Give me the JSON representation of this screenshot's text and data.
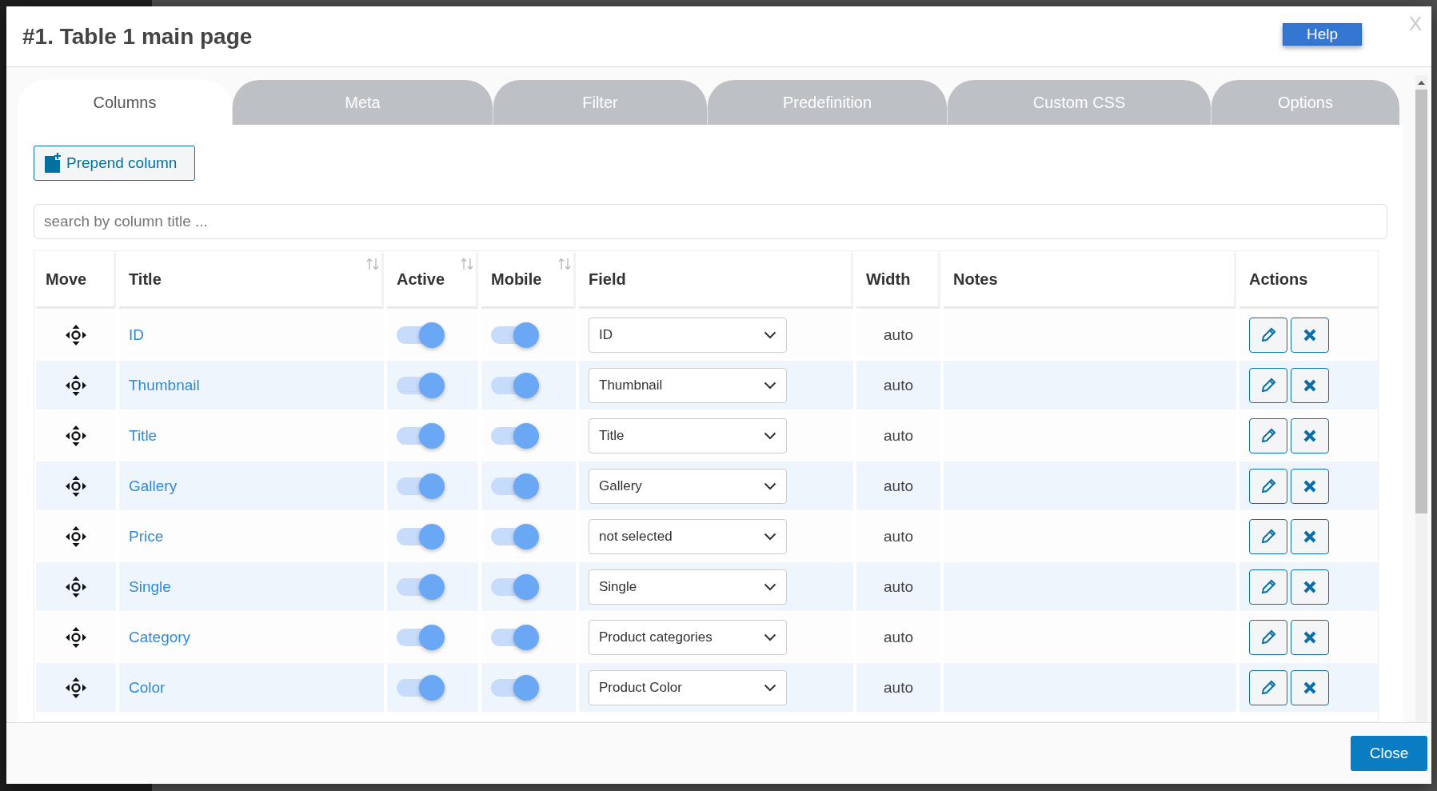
{
  "dialog": {
    "title": "#1. Table 1 main page",
    "help_button": "Help",
    "close_x": "X",
    "close_button": "Close"
  },
  "tabs": [
    {
      "label": "Columns",
      "selected": true
    },
    {
      "label": "Meta",
      "selected": false
    },
    {
      "label": "Filter",
      "selected": false
    },
    {
      "label": "Predefinition",
      "selected": false
    },
    {
      "label": "Custom CSS",
      "selected": false
    },
    {
      "label": "Options",
      "selected": false
    }
  ],
  "prepend_button": "Prepend column",
  "search": {
    "placeholder": "search by column title ..."
  },
  "table": {
    "columns": [
      {
        "label": "Move",
        "sortable": false
      },
      {
        "label": "Title",
        "sortable": true
      },
      {
        "label": "Active",
        "sortable": true
      },
      {
        "label": "Mobile",
        "sortable": true
      },
      {
        "label": "Field",
        "sortable": false
      },
      {
        "label": "Width",
        "sortable": false
      },
      {
        "label": "Notes",
        "sortable": false
      },
      {
        "label": "Actions",
        "sortable": false
      }
    ],
    "rows": [
      {
        "title": "ID",
        "active": true,
        "mobile": true,
        "field": "ID",
        "width": "auto"
      },
      {
        "title": "Thumbnail",
        "active": true,
        "mobile": true,
        "field": "Thumbnail",
        "width": "auto"
      },
      {
        "title": "Title",
        "active": true,
        "mobile": true,
        "field": "Title",
        "width": "auto"
      },
      {
        "title": "Gallery",
        "active": true,
        "mobile": true,
        "field": "Gallery",
        "width": "auto"
      },
      {
        "title": "Price",
        "active": true,
        "mobile": true,
        "field": "not selected",
        "width": "auto"
      },
      {
        "title": "Single",
        "active": true,
        "mobile": true,
        "field": "Single",
        "width": "auto"
      },
      {
        "title": "Category",
        "active": true,
        "mobile": true,
        "field": "Product categories",
        "width": "auto"
      },
      {
        "title": "Color",
        "active": true,
        "mobile": true,
        "field": "Product Color",
        "width": "auto"
      }
    ]
  }
}
